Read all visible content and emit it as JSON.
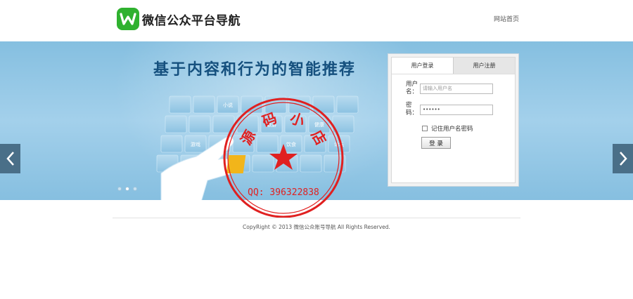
{
  "header": {
    "logo_icon": "wechat-w-icon",
    "logo_text": "微信公众平台导航",
    "home_link": "网站首页"
  },
  "banner": {
    "headline": "基于内容和行为的智能推荐",
    "tiles": [
      "小说",
      "健康",
      "游戏",
      "饮食",
      "论坛",
      "旅游"
    ],
    "dots": 3,
    "active_dot": 1,
    "prev_icon": "chevron-left-icon",
    "next_icon": "chevron-right-icon"
  },
  "login": {
    "tab_login": "用户登录",
    "tab_register": "用户注册",
    "username_label": "用户名：",
    "username_placeholder": "请输入用户名",
    "password_label": "密　码：",
    "password_value": "••••••",
    "remember_label": "记住用户名密码",
    "submit_label": "登 录"
  },
  "stamp": {
    "text": "源码小店",
    "qq": "QQ: 396322838",
    "color": "#e02020"
  },
  "footer": {
    "copyright": "CopyRight © 2013 微信公众账号导航 All Rights Reserved."
  }
}
